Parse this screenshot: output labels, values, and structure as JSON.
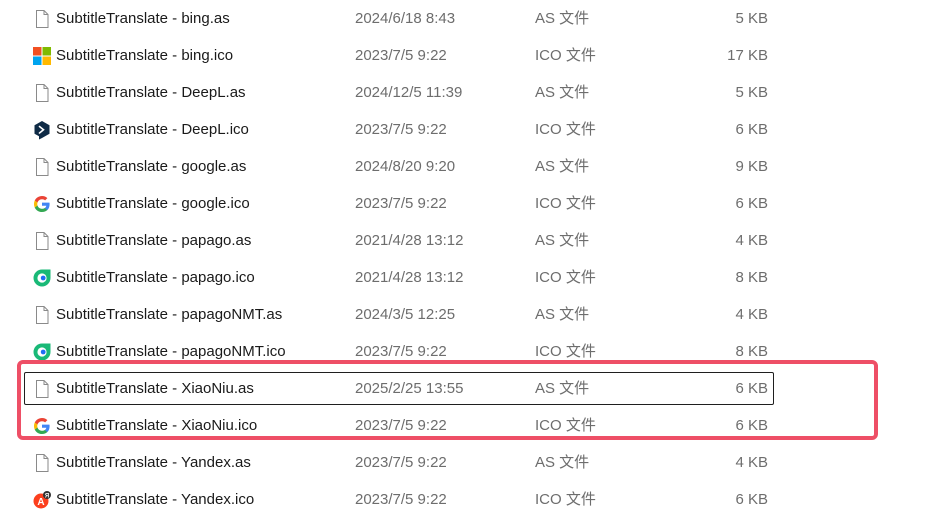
{
  "files": [
    {
      "name": "SubtitleTranslate - bing.as",
      "date": "2024/6/18 8:43",
      "type": "AS 文件",
      "size": "5 KB",
      "icon": "file-icon"
    },
    {
      "name": "SubtitleTranslate - bing.ico",
      "date": "2023/7/5 9:22",
      "type": "ICO 文件",
      "size": "17 KB",
      "icon": "bing-windows-icon"
    },
    {
      "name": "SubtitleTranslate - DeepL.as",
      "date": "2024/12/5 11:39",
      "type": "AS 文件",
      "size": "5 KB",
      "icon": "file-icon"
    },
    {
      "name": "SubtitleTranslate - DeepL.ico",
      "date": "2023/7/5 9:22",
      "type": "ICO 文件",
      "size": "6 KB",
      "icon": "deepl-icon"
    },
    {
      "name": "SubtitleTranslate - google.as",
      "date": "2024/8/20 9:20",
      "type": "AS 文件",
      "size": "9 KB",
      "icon": "file-icon"
    },
    {
      "name": "SubtitleTranslate - google.ico",
      "date": "2023/7/5 9:22",
      "type": "ICO 文件",
      "size": "6 KB",
      "icon": "google-icon"
    },
    {
      "name": "SubtitleTranslate - papago.as",
      "date": "2021/4/28 13:12",
      "type": "AS 文件",
      "size": "4 KB",
      "icon": "file-icon"
    },
    {
      "name": "SubtitleTranslate - papago.ico",
      "date": "2021/4/28 13:12",
      "type": "ICO 文件",
      "size": "8 KB",
      "icon": "papago-icon"
    },
    {
      "name": "SubtitleTranslate - papagoNMT.as",
      "date": "2024/3/5 12:25",
      "type": "AS 文件",
      "size": "4 KB",
      "icon": "file-icon"
    },
    {
      "name": "SubtitleTranslate - papagoNMT.ico",
      "date": "2023/7/5 9:22",
      "type": "ICO 文件",
      "size": "8 KB",
      "icon": "papago-icon"
    },
    {
      "name": "SubtitleTranslate - XiaoNiu.as",
      "date": "2025/2/25 13:55",
      "type": "AS 文件",
      "size": "6 KB",
      "icon": "file-icon",
      "focused": true
    },
    {
      "name": "SubtitleTranslate - XiaoNiu.ico",
      "date": "2023/7/5 9:22",
      "type": "ICO 文件",
      "size": "6 KB",
      "icon": "google-icon"
    },
    {
      "name": "SubtitleTranslate - Yandex.as",
      "date": "2023/7/5 9:22",
      "type": "AS 文件",
      "size": "4 KB",
      "icon": "file-icon"
    },
    {
      "name": "SubtitleTranslate - Yandex.ico",
      "date": "2023/7/5 9:22",
      "type": "ICO 文件",
      "size": "6 KB",
      "icon": "yandex-icon"
    }
  ],
  "colors": {
    "highlight": "#ee4f66",
    "text_primary": "#1a1a1a",
    "text_secondary": "#6d6d6d"
  }
}
